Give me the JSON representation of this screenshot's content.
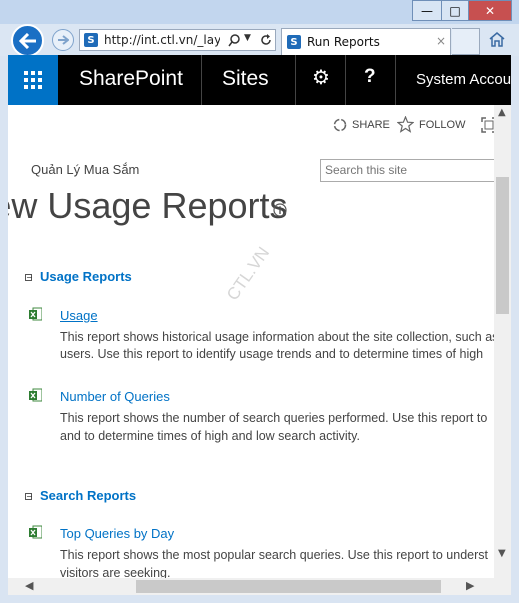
{
  "browser": {
    "url": "http://int.ctl.vn/_layou",
    "tab_title": "Run Reports",
    "window_buttons": {
      "minimize": "—",
      "maximize": "□",
      "close": "✕"
    }
  },
  "suite_bar": {
    "brand": "SharePoint",
    "sites": "Sites",
    "user": "System Account"
  },
  "page": {
    "actions": {
      "share": "SHARE",
      "follow": "FOLLOW"
    },
    "site_name": "Quản Lý Mua Sắm",
    "search_placeholder": "Search this site",
    "title": "View Usage Reports",
    "watermark": "CTL.VN"
  },
  "sections": [
    {
      "title": "Usage Reports",
      "reports": [
        {
          "name": "Usage",
          "line1": "This report shows historical usage information about the site collection, such as",
          "line2": "users. Use this report to identify usage trends and to determine times of high"
        },
        {
          "name": "Number of Queries",
          "line1": "This report shows the number of search queries performed. Use this report to",
          "line2": "and to determine times of high and low search activity."
        }
      ]
    },
    {
      "title": "Search Reports",
      "reports": [
        {
          "name": "Top Queries by Day",
          "line1": "This report shows the most popular search queries. Use this report to underst",
          "line2": "visitors are seeking."
        }
      ]
    }
  ]
}
